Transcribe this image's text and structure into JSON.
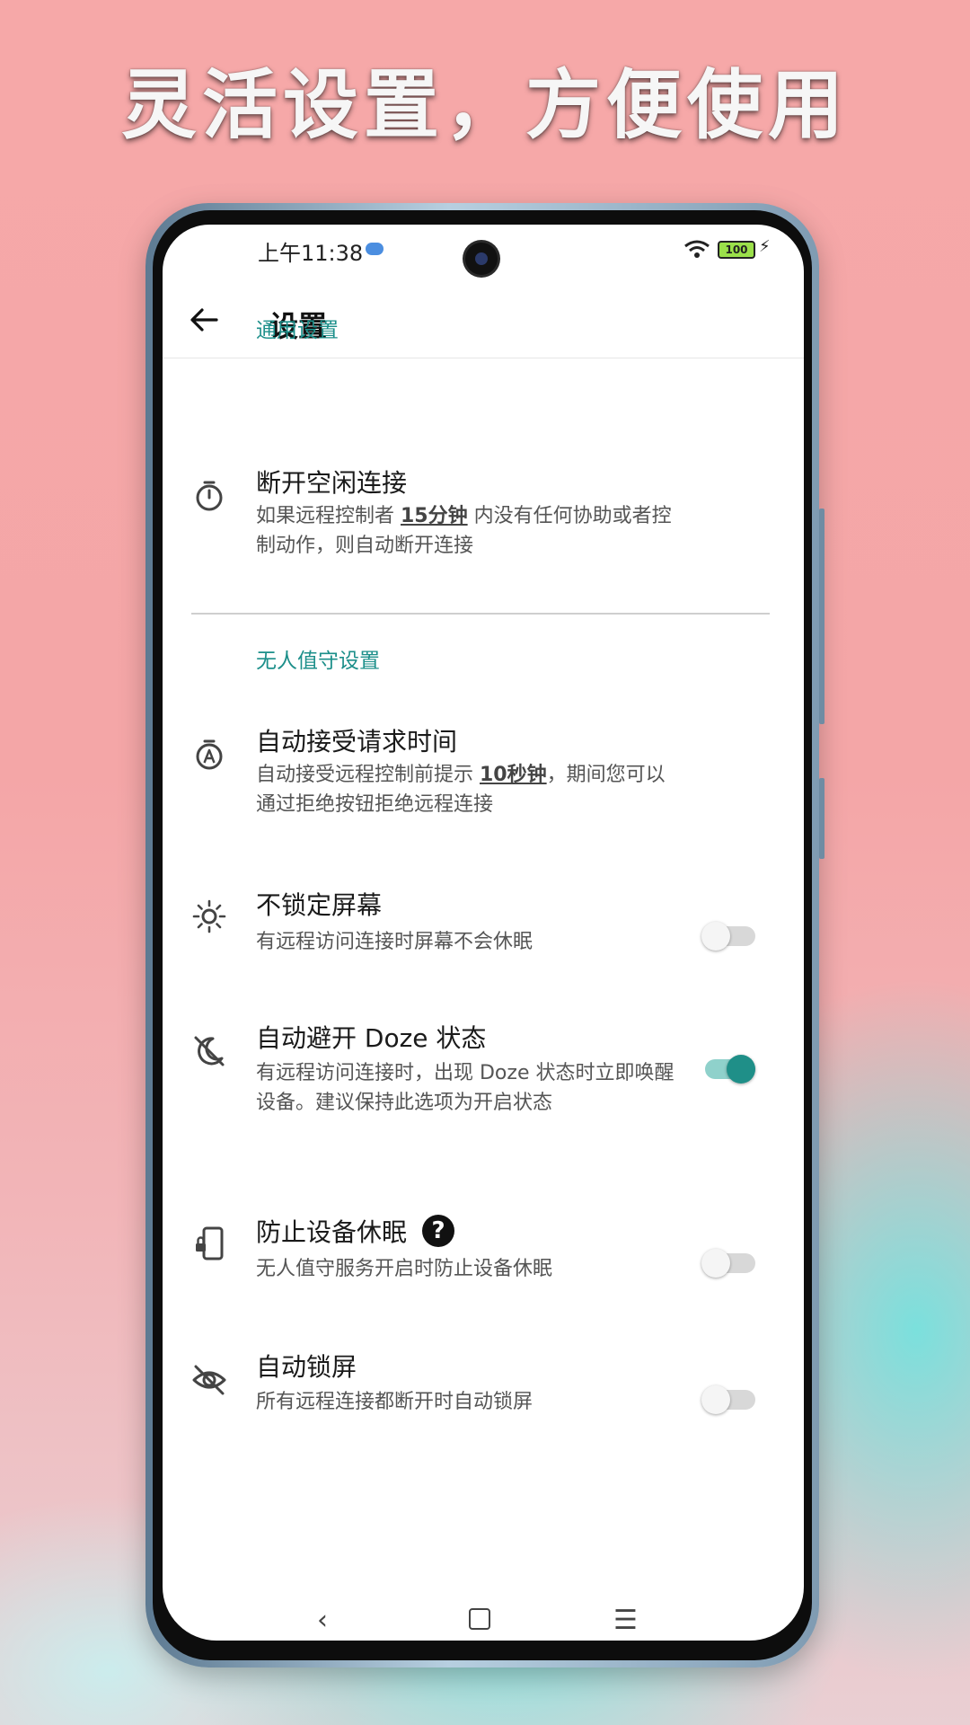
{
  "headline": "灵活设置，方便使用",
  "status_bar": {
    "time": "上午11:38",
    "battery": "100"
  },
  "appbar": {
    "title": "设置"
  },
  "sections": {
    "general": "通用设置",
    "unattended": "无人值守设置"
  },
  "items": {
    "idle": {
      "title": "断开空闲连接",
      "summary_pre": "如果远程控制者 ",
      "summary_value": "15分钟",
      "summary_post": " 内没有任何协助或者控制动作，则自动断开连接"
    },
    "auto_accept": {
      "title": "自动接受请求时间",
      "summary_pre": "自动接受远程控制前提示 ",
      "summary_value": "10秒钟",
      "summary_post": "，期间您可以通过拒绝按钮拒绝远程连接"
    },
    "no_lock": {
      "title": "不锁定屏幕",
      "summary": "有远程访问连接时屏幕不会休眠",
      "enabled": false
    },
    "doze": {
      "title": "自动避开 Doze 状态",
      "summary": "有远程访问连接时，出现 Doze 状态时立即唤醒设备。建议保持此选项为开启状态",
      "enabled": true
    },
    "prevent_sleep": {
      "title": "防止设备休眠",
      "help": "?",
      "summary": "无人值守服务开启时防止设备休眠",
      "enabled": false
    },
    "auto_lock": {
      "title": "自动锁屏",
      "summary": "所有远程连接都断开时自动锁屏",
      "enabled": false
    }
  },
  "navbar": {
    "back": "‹",
    "menu": "☰"
  },
  "colors": {
    "accent": "#1f8f88",
    "section": "#1c8f8a"
  }
}
